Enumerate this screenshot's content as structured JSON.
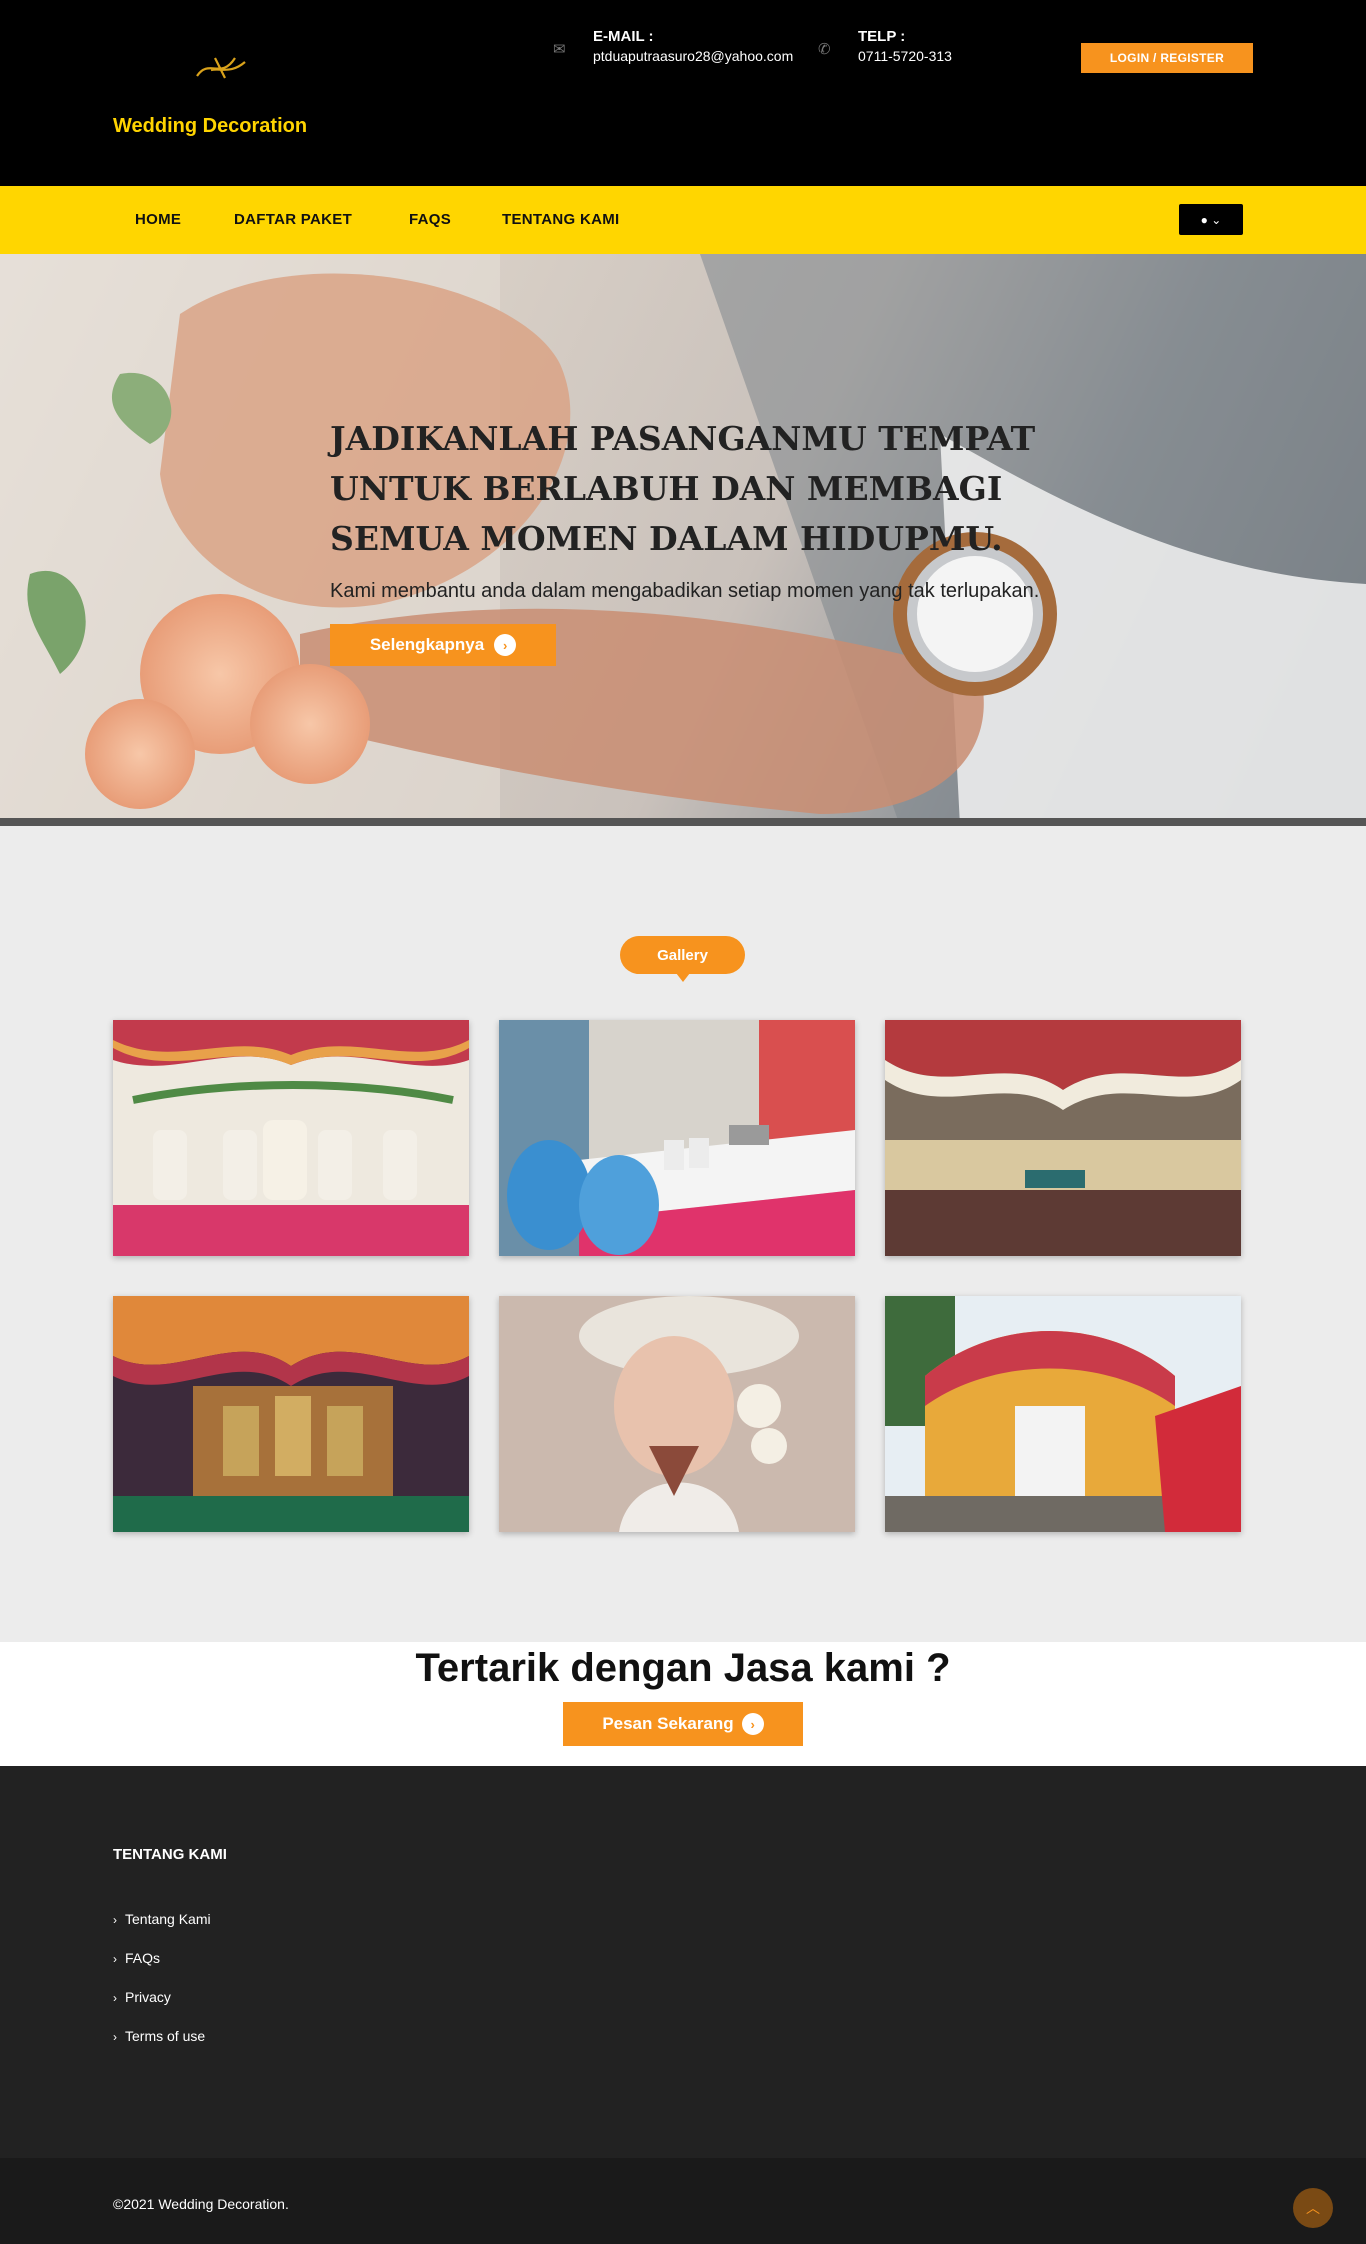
{
  "header": {
    "brand": "Wedding Decoration",
    "email_label": "E-MAIL :",
    "email_value": "ptduaputraasuro28@yahoo.com",
    "phone_label": "TELP :",
    "phone_value": "0711-5720-313",
    "login_label": "LOGIN / REGISTER"
  },
  "nav": {
    "items": [
      "HOME",
      "DAFTAR PAKET",
      "FAQS",
      "TENTANG KAMI"
    ]
  },
  "hero": {
    "title": "JADIKANLAH PASANGANMU TEMPAT UNTUK BERLABUH DAN MEMBAGI SEMUA MOMEN DALAM HIDUPMU.",
    "subtitle": "Kami membantu anda dalam mengabadikan setiap momen yang tak terlupakan.",
    "button_label": "Selengkapnya"
  },
  "gallery": {
    "label": "Gallery"
  },
  "cta": {
    "title": "Tertarik dengan Jasa kami ?",
    "button_label": "Pesan Sekarang"
  },
  "footer": {
    "title": "TENTANG KAMI",
    "links": [
      "Tentang Kami",
      "FAQs",
      "Privacy",
      "Terms of use"
    ],
    "copyright": "©2021 Wedding Decoration."
  },
  "colors": {
    "accent": "#f7931e",
    "nav_bg": "#ffd600",
    "header_bg": "#000000",
    "brand_text": "#ffd400",
    "footer_bg": "#222222"
  }
}
